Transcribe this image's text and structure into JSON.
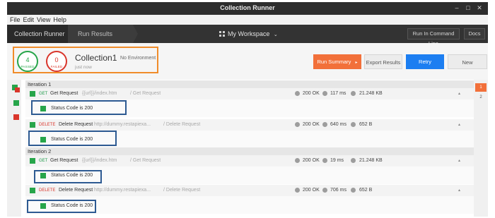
{
  "window": {
    "title": "Collection Runner",
    "controls": [
      "–",
      "□",
      "✕"
    ]
  },
  "menu": {
    "file": "File",
    "edit": "Edit",
    "view": "View",
    "help": "Help"
  },
  "toolbar": {
    "crumb1": "Collection Runner",
    "crumb2": "Run Results",
    "workspace": "My Workspace",
    "run_cmd": "Run In Command Line",
    "docs": "Docs"
  },
  "summary": {
    "passed_count": "4",
    "passed_label": "PASSED",
    "failed_count": "0",
    "failed_label": "FAILED",
    "collection_name": "Collection1",
    "environment": "No Environment",
    "time": "just now",
    "run_summary": "Run Summary",
    "export": "Export Results",
    "retry": "Retry",
    "new": "New"
  },
  "iterations": [
    {
      "label": "Iteration 1",
      "requests": [
        {
          "method": "GET",
          "name": "Get Request",
          "url": "{{url}}/index.htm",
          "path": "/ Get Request",
          "status": "200 OK",
          "time": "117 ms",
          "size": "21.248 KB",
          "test": "Status Code is 200"
        },
        {
          "method": "DELETE",
          "name": "Delete Request",
          "url": "http://dummy.restapiexa...",
          "path": "/ Delete Request",
          "status": "200 OK",
          "time": "640 ms",
          "size": "652 B",
          "test": "Status Code is 200"
        }
      ]
    },
    {
      "label": "Iteration 2",
      "requests": [
        {
          "method": "GET",
          "name": "Get Request",
          "url": "{{url}}/index.htm",
          "path": "/ Get Request",
          "status": "200 OK",
          "time": "19 ms",
          "size": "21.248 KB",
          "test": "Status Code is 200"
        },
        {
          "method": "DELETE",
          "name": "Delete Request",
          "url": "http://dummy.restapiexa...",
          "path": "/ Delete Request",
          "status": "200 OK",
          "time": "706 ms",
          "size": "652 B",
          "test": "Status Code is 200"
        }
      ]
    }
  ],
  "pager": {
    "p1": "1",
    "p2": "2"
  },
  "colors": {
    "accent": "#f2703a",
    "retry": "#1c7ef1",
    "passed": "#27a54a",
    "failed": "#d9352b",
    "highlight_orange": "#f08c2a",
    "highlight_blue": "#2d5a92"
  }
}
